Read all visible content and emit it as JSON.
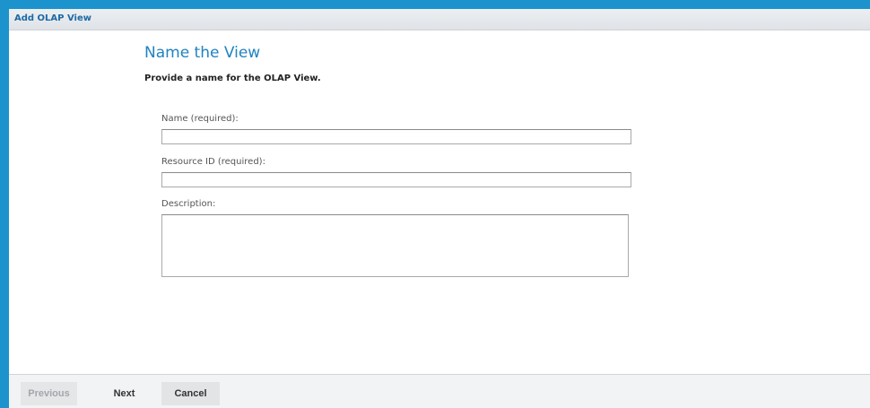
{
  "dialog": {
    "title": "Add OLAP View"
  },
  "page": {
    "heading": "Name the View",
    "instruction": "Provide a name for the OLAP View."
  },
  "fields": {
    "name": {
      "label": "Name (required):",
      "value": ""
    },
    "resource_id": {
      "label": "Resource ID (required):",
      "value": ""
    },
    "description": {
      "label": "Description:",
      "value": ""
    }
  },
  "footer": {
    "previous_label": "Previous",
    "next_label": "Next",
    "cancel_label": "Cancel"
  },
  "colors": {
    "accent": "#1c93cd",
    "heading": "#1f83c0",
    "header_title": "#1e6aa6",
    "disabled_text": "#a3a7ab"
  }
}
